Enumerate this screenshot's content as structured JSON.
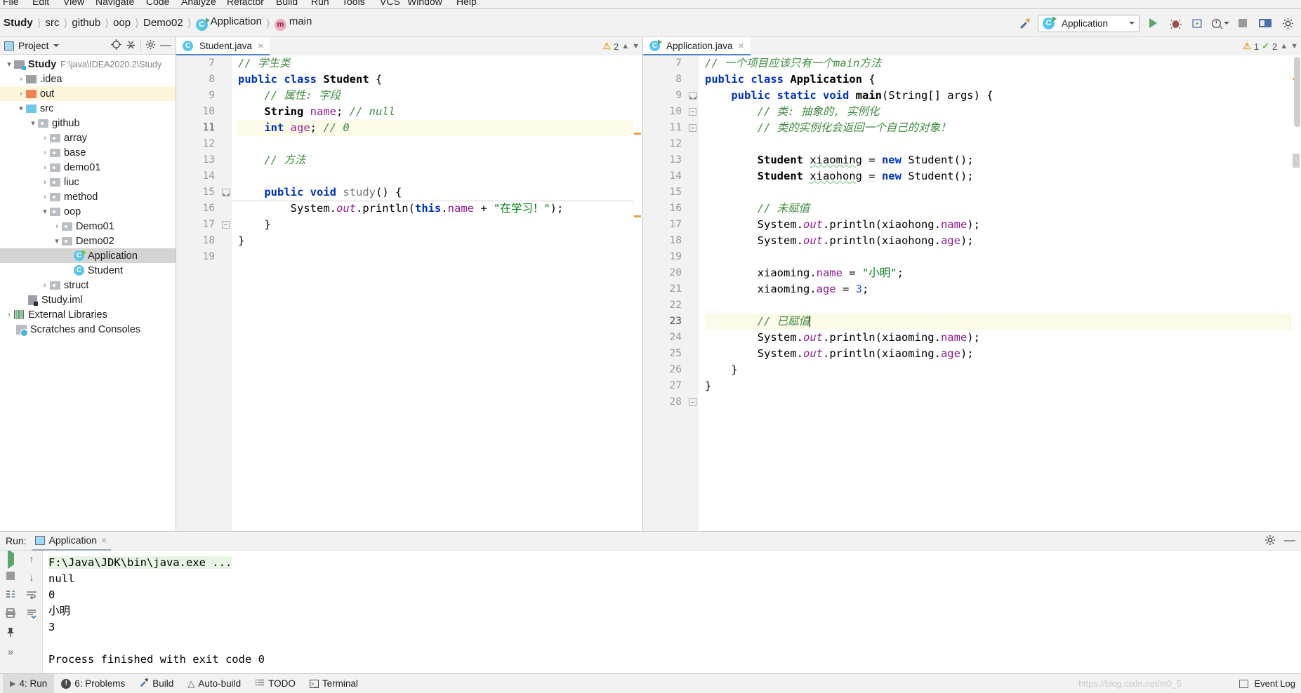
{
  "menu": {
    "items": [
      "File",
      "Edit",
      "View",
      "Navigate",
      "Code",
      "Analyze",
      "Refactor",
      "Build",
      "Run",
      "Tools",
      "VCS",
      "Window",
      "Help"
    ]
  },
  "breadcrumb": {
    "items": [
      {
        "label": "Study",
        "icon": "",
        "bold": true
      },
      {
        "label": "src",
        "icon": ""
      },
      {
        "label": "github",
        "icon": ""
      },
      {
        "label": "oop",
        "icon": ""
      },
      {
        "label": "Demo02",
        "icon": ""
      },
      {
        "label": "Application",
        "icon": "java-class-run-icon"
      },
      {
        "label": "main",
        "icon": "method-icon"
      }
    ]
  },
  "toolbar": {
    "run_config": "Application",
    "run_label": "Run",
    "debug_label": "Debug",
    "coverage_label": "Run with Coverage",
    "profile_label": "Profile",
    "stop_label": "Stop",
    "hammer_label": "Build Project"
  },
  "sidebar": {
    "title": "Project",
    "locate_icon": "locate-icon",
    "collapse_icon": "collapse-all-icon",
    "settings_icon": "gear-icon",
    "tree": [
      {
        "label": "Study",
        "path": "F:\\java\\IDEA2020.2\\Study",
        "depth": 0,
        "arrow": "v",
        "icon": "module-folder",
        "bold": true
      },
      {
        "label": ".idea",
        "depth": 1,
        "arrow": ">",
        "icon": "folder-gray"
      },
      {
        "label": "out",
        "depth": 1,
        "arrow": ">",
        "icon": "folder-orange",
        "highlight": true
      },
      {
        "label": "src",
        "depth": 1,
        "arrow": "v",
        "icon": "folder-blue"
      },
      {
        "label": "github",
        "depth": 2,
        "arrow": "v",
        "icon": "folder-package"
      },
      {
        "label": "array",
        "depth": 3,
        "arrow": ">",
        "icon": "folder-package"
      },
      {
        "label": "base",
        "depth": 3,
        "arrow": ">",
        "icon": "folder-package"
      },
      {
        "label": "demo01",
        "depth": 3,
        "arrow": ">",
        "icon": "folder-package"
      },
      {
        "label": "liuc",
        "depth": 3,
        "arrow": ">",
        "icon": "folder-package"
      },
      {
        "label": "method",
        "depth": 3,
        "arrow": ">",
        "icon": "folder-package"
      },
      {
        "label": "oop",
        "depth": 3,
        "arrow": "v",
        "icon": "folder-package"
      },
      {
        "label": "Demo01",
        "depth": 4,
        "arrow": ">",
        "icon": "folder-package"
      },
      {
        "label": "Demo02",
        "depth": 4,
        "arrow": "v",
        "icon": "folder-package"
      },
      {
        "label": "Application",
        "depth": 5,
        "arrow": "",
        "icon": "java-class-run",
        "selected": true
      },
      {
        "label": "Student",
        "depth": 5,
        "arrow": "",
        "icon": "java-class"
      },
      {
        "label": "struct",
        "depth": 3,
        "arrow": ">",
        "icon": "folder-package"
      },
      {
        "label": "Study.iml",
        "depth": 1,
        "arrow": "",
        "icon": "iml-file"
      },
      {
        "label": "External Libraries",
        "depth": 0,
        "arrow": ">",
        "icon": "libraries"
      },
      {
        "label": "Scratches and Consoles",
        "depth": 0,
        "arrow": "",
        "icon": "scratches"
      }
    ]
  },
  "editor_left": {
    "tab": {
      "label": "Student.java",
      "icon": "java-class-icon",
      "close": "×"
    },
    "inspection": {
      "warning_count": "2",
      "warning_icon": "warning-triangle",
      "up": "⌃",
      "down": "⌄"
    },
    "first_line": 7,
    "lines": [
      {
        "n": 7,
        "tokens": [
          {
            "t": "// 学生类",
            "c": "cmt",
            "indent": 0
          }
        ]
      },
      {
        "n": 8,
        "tokens": [
          {
            "t": "public ",
            "c": "kw"
          },
          {
            "t": "class ",
            "c": "kw"
          },
          {
            "t": "Student ",
            "c": "typ"
          },
          {
            "t": "{",
            "c": "pln"
          }
        ]
      },
      {
        "n": 9,
        "tokens": [
          {
            "t": "    // 属性: 字段",
            "c": "cmt"
          }
        ]
      },
      {
        "n": 10,
        "tokens": [
          {
            "t": "    ",
            "c": "pln"
          },
          {
            "t": "String ",
            "c": "typ"
          },
          {
            "t": "name",
            "c": "fld"
          },
          {
            "t": "; ",
            "c": "pln"
          },
          {
            "t": "// null",
            "c": "cmt"
          }
        ]
      },
      {
        "n": 11,
        "cur": true,
        "tokens": [
          {
            "t": "    ",
            "c": "pln"
          },
          {
            "t": "int ",
            "c": "kw"
          },
          {
            "t": "age",
            "c": "fld"
          },
          {
            "t": "; ",
            "c": "pln"
          },
          {
            "t": "// 0",
            "c": "cmt"
          }
        ]
      },
      {
        "n": 12,
        "tokens": []
      },
      {
        "n": 13,
        "tokens": [
          {
            "t": "    // 方法",
            "c": "cmt"
          }
        ]
      },
      {
        "n": 14,
        "tokens": []
      },
      {
        "n": 15,
        "tokens": [
          {
            "t": "    ",
            "c": "pln"
          },
          {
            "t": "public ",
            "c": "kw"
          },
          {
            "t": "void ",
            "c": "kw"
          },
          {
            "t": "study",
            "c": "mth"
          },
          {
            "t": "() {",
            "c": "pln"
          }
        ]
      },
      {
        "n": 16,
        "tokens": [
          {
            "t": "        System.",
            "c": "pln"
          },
          {
            "t": "out",
            "c": "sta"
          },
          {
            "t": ".println(",
            "c": "pln"
          },
          {
            "t": "this",
            "c": "kw"
          },
          {
            "t": ".",
            "c": "pln"
          },
          {
            "t": "name",
            "c": "fld"
          },
          {
            "t": " + ",
            "c": "pln"
          },
          {
            "t": "\"在学习！\"",
            "c": "str"
          },
          {
            "t": ");",
            "c": "pln"
          }
        ]
      },
      {
        "n": 17,
        "tokens": [
          {
            "t": "    }",
            "c": "pln"
          }
        ]
      },
      {
        "n": 18,
        "tokens": [
          {
            "t": "}",
            "c": "pln"
          }
        ]
      },
      {
        "n": 19,
        "tokens": []
      }
    ]
  },
  "editor_right": {
    "tab": {
      "label": "Application.java",
      "icon": "java-class-run-icon",
      "close": "×"
    },
    "inspection": {
      "warning_count": "1",
      "warning_icon": "warning-triangle",
      "ok_count": "2",
      "ok_icon": "check-icon",
      "up": "⌃",
      "down": "⌄"
    },
    "first_line": 7,
    "lines": [
      {
        "n": 7,
        "tokens": [
          {
            "t": "// 一个项目应该只有一个main方法",
            "c": "cmt"
          }
        ]
      },
      {
        "n": 8,
        "runmark": true,
        "tokens": [
          {
            "t": "public ",
            "c": "kw"
          },
          {
            "t": "class ",
            "c": "kw"
          },
          {
            "t": "Application ",
            "c": "typ"
          },
          {
            "t": "{",
            "c": "pln"
          }
        ]
      },
      {
        "n": 9,
        "runmark": true,
        "tokens": [
          {
            "t": "    ",
            "c": "pln"
          },
          {
            "t": "public ",
            "c": "kw"
          },
          {
            "t": "static ",
            "c": "kw"
          },
          {
            "t": "void ",
            "c": "kw"
          },
          {
            "t": "main",
            "c": "typ"
          },
          {
            "t": "(String[] args) {",
            "c": "pln"
          }
        ]
      },
      {
        "n": 10,
        "tokens": [
          {
            "t": "        // 类: 抽象的, 实例化",
            "c": "cmt"
          }
        ]
      },
      {
        "n": 11,
        "tokens": [
          {
            "t": "        // 类的实例化会返回一个自己的对象！",
            "c": "cmt"
          }
        ]
      },
      {
        "n": 12,
        "tokens": []
      },
      {
        "n": 13,
        "tokens": [
          {
            "t": "        ",
            "c": "pln"
          },
          {
            "t": "Student ",
            "c": "typ"
          },
          {
            "t": "xiaoming",
            "c": "pln wavy"
          },
          {
            "t": " = ",
            "c": "pln"
          },
          {
            "t": "new ",
            "c": "kw"
          },
          {
            "t": "Student();",
            "c": "pln"
          }
        ]
      },
      {
        "n": 14,
        "tokens": [
          {
            "t": "        ",
            "c": "pln"
          },
          {
            "t": "Student ",
            "c": "typ"
          },
          {
            "t": "xiaohong",
            "c": "pln wavy"
          },
          {
            "t": " = ",
            "c": "pln"
          },
          {
            "t": "new ",
            "c": "kw"
          },
          {
            "t": "Student();",
            "c": "pln"
          }
        ]
      },
      {
        "n": 15,
        "tokens": []
      },
      {
        "n": 16,
        "tokens": [
          {
            "t": "        // 未赋值",
            "c": "cmt"
          }
        ]
      },
      {
        "n": 17,
        "tokens": [
          {
            "t": "        System.",
            "c": "pln"
          },
          {
            "t": "out",
            "c": "sta"
          },
          {
            "t": ".println(xiaohong.",
            "c": "pln"
          },
          {
            "t": "name",
            "c": "fld"
          },
          {
            "t": ");",
            "c": "pln"
          }
        ]
      },
      {
        "n": 18,
        "tokens": [
          {
            "t": "        System.",
            "c": "pln"
          },
          {
            "t": "out",
            "c": "sta"
          },
          {
            "t": ".println(xiaohong.",
            "c": "pln"
          },
          {
            "t": "age",
            "c": "fld"
          },
          {
            "t": ");",
            "c": "pln"
          }
        ]
      },
      {
        "n": 19,
        "tokens": []
      },
      {
        "n": 20,
        "tokens": [
          {
            "t": "        xiaoming.",
            "c": "pln"
          },
          {
            "t": "name",
            "c": "fld"
          },
          {
            "t": " = ",
            "c": "pln"
          },
          {
            "t": "\"小明\"",
            "c": "str"
          },
          {
            "t": ";",
            "c": "pln"
          }
        ]
      },
      {
        "n": 21,
        "tokens": [
          {
            "t": "        xiaoming.",
            "c": "pln"
          },
          {
            "t": "age",
            "c": "fld"
          },
          {
            "t": " = ",
            "c": "pln"
          },
          {
            "t": "3",
            "c": "num"
          },
          {
            "t": ";",
            "c": "pln"
          }
        ]
      },
      {
        "n": 22,
        "tokens": []
      },
      {
        "n": 23,
        "cur": true,
        "caret": true,
        "tokens": [
          {
            "t": "        // 已赋值",
            "c": "cmt"
          }
        ]
      },
      {
        "n": 24,
        "tokens": [
          {
            "t": "        System.",
            "c": "pln"
          },
          {
            "t": "out",
            "c": "sta"
          },
          {
            "t": ".println(xiaoming.",
            "c": "pln"
          },
          {
            "t": "name",
            "c": "fld"
          },
          {
            "t": ");",
            "c": "pln"
          }
        ]
      },
      {
        "n": 25,
        "tokens": [
          {
            "t": "        System.",
            "c": "pln"
          },
          {
            "t": "out",
            "c": "sta"
          },
          {
            "t": ".println(xiaoming.",
            "c": "pln"
          },
          {
            "t": "age",
            "c": "fld"
          },
          {
            "t": ");",
            "c": "pln"
          }
        ]
      },
      {
        "n": 26,
        "tokens": [
          {
            "t": "    }",
            "c": "pln"
          }
        ]
      },
      {
        "n": 27,
        "tokens": [
          {
            "t": "}",
            "c": "pln"
          }
        ]
      },
      {
        "n": 28,
        "tokens": []
      }
    ]
  },
  "run_window": {
    "label": "Run:",
    "tab": "Application",
    "tab_close": "×",
    "settings_icon": "gear-icon",
    "minimize_icon": "minimize-icon",
    "side_icons": [
      "rerun-icon",
      "stop-icon",
      "toggle-tasks-icon",
      "print-icon",
      "pin-icon",
      "more-icon"
    ],
    "side_icons2": [
      "up-icon",
      "down-icon",
      "soft-wrap-icon",
      "scroll-to-end-icon"
    ],
    "console": [
      {
        "text": "F:\\Java\\JDK\\bin\\java.exe ...",
        "cmd": true
      },
      {
        "text": "null"
      },
      {
        "text": "0"
      },
      {
        "text": "小明"
      },
      {
        "text": "3"
      },
      {
        "text": ""
      },
      {
        "text": "Process finished with exit code 0"
      }
    ]
  },
  "statusbar": {
    "items": [
      {
        "label": "4: Run",
        "underline": "4",
        "icon": "run-triangle-icon",
        "active": true
      },
      {
        "label": "6: Problems",
        "underline": "6",
        "icon": "error-circle-icon"
      },
      {
        "label": "Build",
        "icon": "hammer-icon"
      },
      {
        "label": "Auto-build",
        "icon": "warning-triangle-icon"
      },
      {
        "label": "TODO",
        "icon": "todo-list-icon"
      },
      {
        "label": "Terminal",
        "icon": "terminal-icon"
      }
    ],
    "watermark": "https://blog.csdn.net/m0_5",
    "event_log": "Event Log",
    "event_log_icon": "event-log-icon"
  }
}
